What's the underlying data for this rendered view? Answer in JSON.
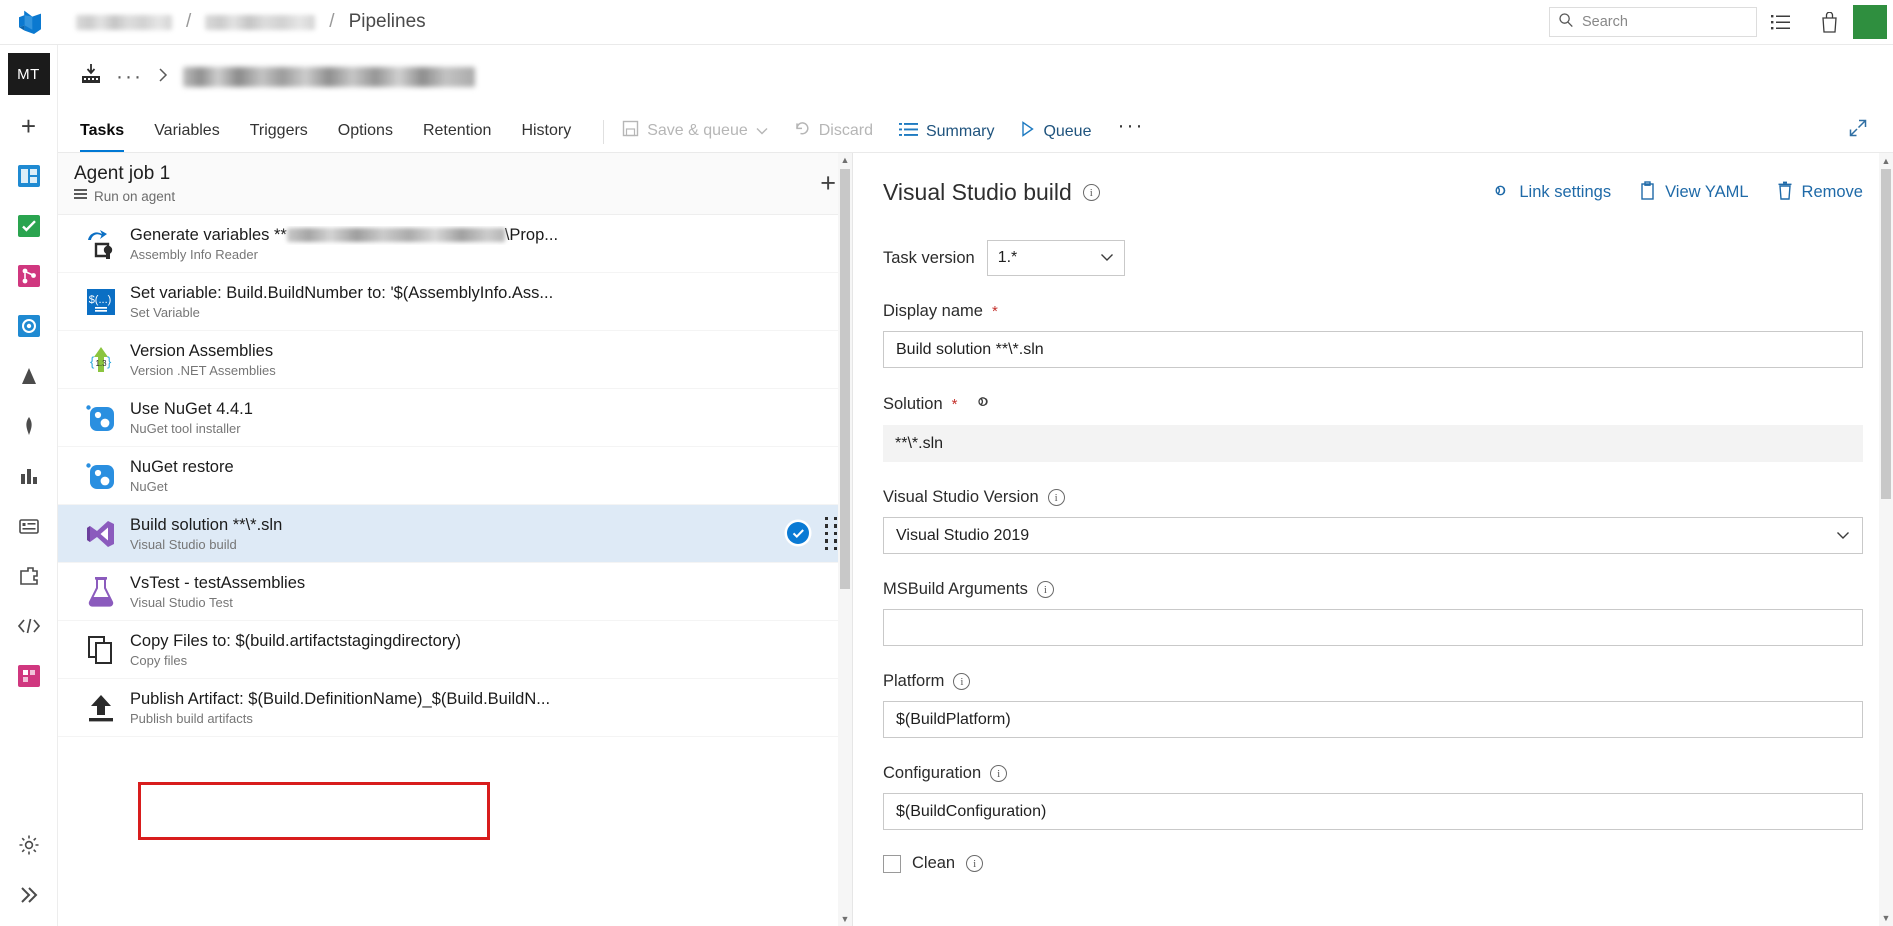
{
  "topbar": {
    "logo_icon": "azure-devops-logo",
    "breadcrumb": [
      {
        "label": "",
        "redacted": true,
        "width": 96
      },
      {
        "label": "/",
        "redacted": false
      },
      {
        "label": "",
        "redacted": true,
        "width": 110
      },
      {
        "label": "/",
        "redacted": false
      },
      {
        "label": "Pipelines",
        "redacted": false
      }
    ],
    "search_placeholder": "Search",
    "search_value": "",
    "search_icon": "search-icon",
    "icons": [
      "list-icon",
      "briefcase-icon"
    ],
    "avatar_initials": ""
  },
  "rail": {
    "project_badge": "MT",
    "items": [
      {
        "name": "add-icon",
        "glyph": "+"
      },
      {
        "name": "overview-icon"
      },
      {
        "name": "boards-icon"
      },
      {
        "name": "repos-icon"
      },
      {
        "name": "pipelines-icon"
      },
      {
        "name": "test-plans-icon"
      },
      {
        "name": "artifacts-icon"
      },
      {
        "name": "analytics-icon"
      },
      {
        "name": "dashboards-icon"
      },
      {
        "name": "extensions-icon"
      },
      {
        "name": "code-icon"
      },
      {
        "name": "plugin-icon"
      }
    ],
    "bottom": [
      {
        "name": "settings-gear-icon"
      },
      {
        "name": "expand-rail-icon"
      }
    ]
  },
  "pipeline": {
    "icon": "build-definition-icon",
    "ellipsis": "···",
    "chevron": "›",
    "title": "",
    "title_redacted": true
  },
  "tabs": [
    {
      "label": "Tasks",
      "active": true
    },
    {
      "label": "Variables",
      "active": false
    },
    {
      "label": "Triggers",
      "active": false
    },
    {
      "label": "Options",
      "active": false
    },
    {
      "label": "Retention",
      "active": false
    },
    {
      "label": "History",
      "active": false
    }
  ],
  "toolbar": [
    {
      "label": "Save & queue",
      "icon": "save-icon",
      "disabled": true,
      "has_chevron": true
    },
    {
      "label": "Discard",
      "icon": "undo-icon",
      "disabled": true,
      "has_chevron": false
    },
    {
      "label": "Summary",
      "icon": "summary-list-icon",
      "disabled": false,
      "link": true
    },
    {
      "label": "Queue",
      "icon": "play-icon",
      "disabled": false,
      "link": true
    },
    {
      "label": "···",
      "icon": "more-icon",
      "disabled": false
    }
  ],
  "expand_icon": "expand-diagonal-icon",
  "job": {
    "title": "Agent job 1",
    "subtitle": "Run on agent",
    "subtitle_icon": "agent-icon",
    "add_label": "+"
  },
  "tasks": [
    {
      "name": "Generate variables **",
      "name_redacted_width": 218,
      "name_suffix": "\\Prop...",
      "subtitle": "Assembly Info Reader",
      "icon": "assembly-info-reader-icon",
      "selected": false
    },
    {
      "name": "Set variable: Build.BuildNumber to: '$(AssemblyInfo.Ass...",
      "subtitle": "Set Variable",
      "icon": "set-variable-icon",
      "selected": false
    },
    {
      "name": "Version Assemblies",
      "subtitle": "Version .NET Assemblies",
      "icon": "version-assemblies-icon",
      "selected": false
    },
    {
      "name": "Use NuGet 4.4.1",
      "subtitle": "NuGet tool installer",
      "icon": "nuget-icon",
      "selected": false
    },
    {
      "name": "NuGet restore",
      "subtitle": "NuGet",
      "icon": "nuget-icon",
      "selected": false
    },
    {
      "name": "Build solution **\\*.sln",
      "subtitle": "Visual Studio build",
      "icon": "visual-studio-icon",
      "selected": true,
      "status_icon": "check-badge-icon",
      "drag_handle": "drag-handle-icon"
    },
    {
      "name": "VsTest - testAssemblies",
      "subtitle": "Visual Studio Test",
      "icon": "vstest-icon",
      "selected": false
    },
    {
      "name": "Copy Files to: $(build.artifactstagingdirectory)",
      "subtitle": "Copy files",
      "icon": "copy-files-icon",
      "selected": false
    },
    {
      "name": "Publish Artifact: $(Build.DefinitionName)_$(Build.BuildN...",
      "subtitle": "Publish build artifacts",
      "icon": "publish-artifact-icon",
      "selected": false
    }
  ],
  "details": {
    "title": "Visual Studio build",
    "title_info_icon": "info-icon",
    "actions": [
      {
        "label": "Link settings",
        "icon": "link-settings-icon"
      },
      {
        "label": "View YAML",
        "icon": "view-yaml-icon"
      },
      {
        "label": "Remove",
        "icon": "trash-icon"
      }
    ],
    "task_version": {
      "label": "Task version",
      "value": "1.*",
      "chevron": "⌄"
    },
    "fields": [
      {
        "label": "Display name",
        "required": true,
        "type": "text",
        "value": "Build solution **\\*.sln",
        "info": false
      },
      {
        "label": "Solution",
        "required": true,
        "type": "readonly",
        "value": "**\\*.sln",
        "link_icon": "link-variable-icon",
        "info": false
      },
      {
        "label": "Visual Studio Version",
        "required": false,
        "type": "select",
        "value": "Visual Studio 2019",
        "info": true
      },
      {
        "label": "MSBuild Arguments",
        "required": false,
        "type": "text",
        "value": "",
        "info": true
      },
      {
        "label": "Platform",
        "required": false,
        "type": "text",
        "value": "$(BuildPlatform)",
        "info": true
      },
      {
        "label": "Configuration",
        "required": false,
        "type": "text",
        "value": "$(BuildConfiguration)",
        "info": true
      }
    ],
    "clean_checkbox": {
      "label": "Clean",
      "checked": false,
      "info": true
    }
  },
  "colors": {
    "accent": "#0078d4",
    "link": "#1f6aa8",
    "selected_row": "#deeaf6",
    "annotation": "#d81d1d",
    "check_badge": "#0a7ad4",
    "avatar": "#2f8f3f"
  }
}
